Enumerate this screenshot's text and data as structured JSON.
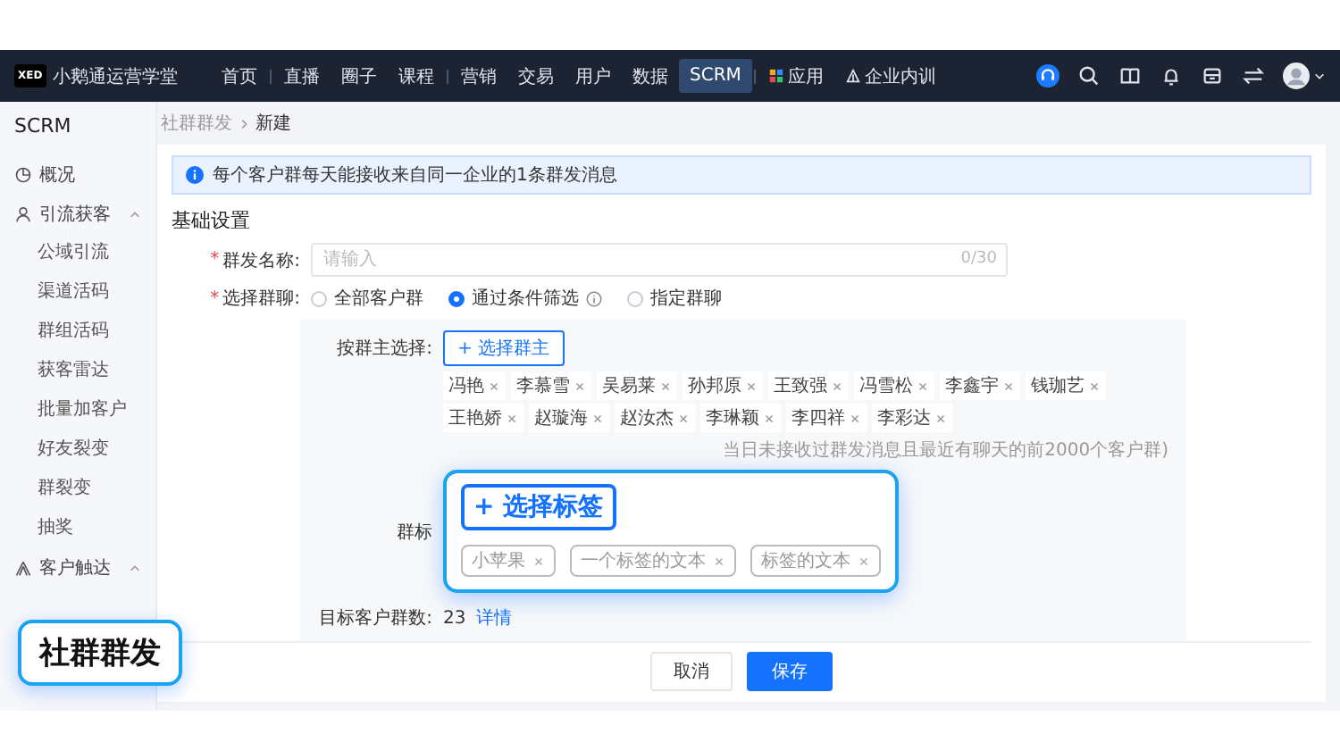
{
  "app": {
    "logo": "XED",
    "name": "小鹅通运营学堂"
  },
  "nav": [
    {
      "label": "首页",
      "selected": false
    },
    {
      "label": "直播",
      "selected": false
    },
    {
      "label": "圈子",
      "selected": false
    },
    {
      "label": "课程",
      "selected": false
    },
    {
      "label": "营销",
      "selected": false
    },
    {
      "label": "交易",
      "selected": false
    },
    {
      "label": "用户",
      "selected": false
    },
    {
      "label": "数据",
      "selected": false
    },
    {
      "label": "SCRM",
      "selected": true
    },
    {
      "label": "应用",
      "selected": false
    },
    {
      "label": "企业内训",
      "selected": false
    }
  ],
  "sidebar": {
    "title": "SCRM",
    "items": [
      {
        "label": "概况"
      },
      {
        "label": "引流获客",
        "expanded": true,
        "children": [
          {
            "label": "公域引流"
          },
          {
            "label": "渠道活码"
          },
          {
            "label": "群组活码"
          },
          {
            "label": "获客雷达"
          },
          {
            "label": "批量加客户"
          },
          {
            "label": "好友裂变"
          },
          {
            "label": "群裂变"
          },
          {
            "label": "抽奖"
          }
        ]
      },
      {
        "label": "客户触达",
        "expanded": true
      }
    ]
  },
  "breadcrumb": [
    "社群群发",
    "新建"
  ],
  "alert": "每个客户群每天能接收来自同一企业的1条群发消息",
  "section_title": "基础设置",
  "name_field": {
    "required": "*",
    "label": "群发名称:",
    "placeholder": "请输入",
    "counter": "0/30"
  },
  "group_select": {
    "required": "*",
    "label": "选择群聊:",
    "options": [
      {
        "label": "全部客户群",
        "selected": false,
        "info": false
      },
      {
        "label": "通过条件筛选",
        "selected": true,
        "info": true
      },
      {
        "label": "指定群聊",
        "selected": false,
        "info": false
      }
    ]
  },
  "owner": {
    "label": "按群主选择:",
    "button": "+ 选择群主",
    "tags": [
      "冯艳",
      "李慕雪",
      "吴易莱",
      "孙邦原",
      "王致强",
      "冯雪松",
      "李鑫宇",
      "钱珈艺",
      "王艳娇",
      "赵璇海",
      "赵汝杰",
      "李琳颖",
      "李四祥",
      "李彩达"
    ]
  },
  "hint": "当日未接收过群发消息且最近有聊天的前2000个客户群)",
  "tag_label": "群标",
  "target": {
    "label": "目标客户群数:",
    "value": "23",
    "link": "详情"
  },
  "buttons": {
    "cancel": "取消",
    "save": "保存"
  },
  "popup": {
    "button": "+ 选择标签",
    "tags": [
      "小苹果",
      "一个标签的文本",
      "标签的文本"
    ]
  },
  "badge": "社群群发"
}
